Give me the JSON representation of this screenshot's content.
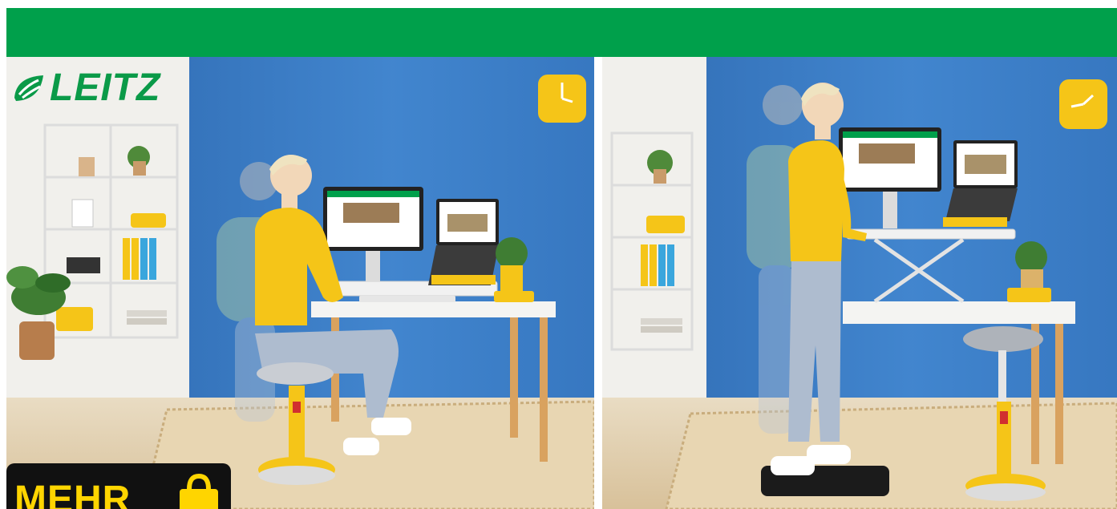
{
  "brand": {
    "name": "LEITZ",
    "color": "#0a9a48"
  },
  "badge": {
    "text": "MEHR",
    "text_color": "#ffd500",
    "background": "#111111"
  },
  "banner": {
    "color": "#00a04b"
  },
  "colors": {
    "wall": "#3c7fc9",
    "accent_yellow": "#f5c518",
    "floor": "#e4d2b2"
  },
  "icons": [
    "leaf-logo-icon",
    "shopping-bag-icon",
    "wall-clock-icon"
  ],
  "scenes": [
    {
      "name": "sitting",
      "description_visible": ""
    },
    {
      "name": "standing",
      "description_visible": ""
    }
  ]
}
